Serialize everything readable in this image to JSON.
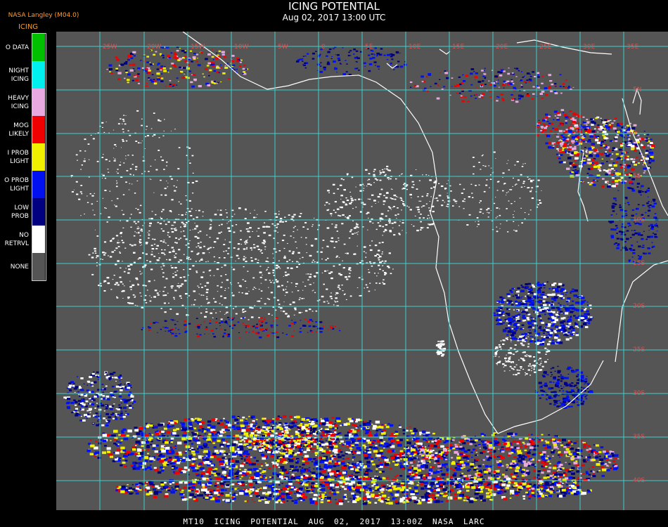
{
  "producer": "NASA Langley (M04.0)",
  "header": {
    "title": "ICING POTENTIAL",
    "subtitle": "Aug 02, 2017 13:00 UTC"
  },
  "legend": {
    "title": "ICING",
    "items": [
      {
        "lines": [
          "O DATA"
        ],
        "color": "#00c000"
      },
      {
        "lines": [
          "NIGHT",
          "ICING"
        ],
        "color": "#00f0f0"
      },
      {
        "lines": [
          "HEAVY",
          "ICING"
        ],
        "color": "#e8a8e0"
      },
      {
        "lines": [
          "MOG",
          "LIKELY"
        ],
        "color": "#f00000"
      },
      {
        "lines": [
          "I PROB",
          "LIGHT"
        ],
        "color": "#f0f000"
      },
      {
        "lines": [
          "O PROB",
          "LIGHT"
        ],
        "color": "#0010f0"
      },
      {
        "lines": [
          "LOW",
          "PROB"
        ],
        "color": "#000080"
      },
      {
        "lines": [
          "NO",
          "RETRVL"
        ],
        "color": "#ffffff"
      },
      {
        "lines": [
          "NONE"
        ],
        "color": "#555555"
      }
    ]
  },
  "map": {
    "background": "#555555",
    "grid_color": "#3ad0d0",
    "coast_color": "#ffffff",
    "label_color": "#e05050",
    "lon_labels": [
      "25W",
      "20W",
      "15W",
      "10W",
      "5W",
      "0",
      "5E",
      "10E",
      "15E",
      "20E",
      "25E",
      "30E",
      "35E"
    ],
    "lat_labels": [
      "5N",
      "0",
      "5S",
      "10S",
      "15S",
      "20S",
      "25S",
      "30S",
      "35S",
      "40S"
    ]
  },
  "footer": {
    "text": "MT10 ICING POTENTIAL AUG 02, 2017 13:00Z NASA LARC"
  }
}
